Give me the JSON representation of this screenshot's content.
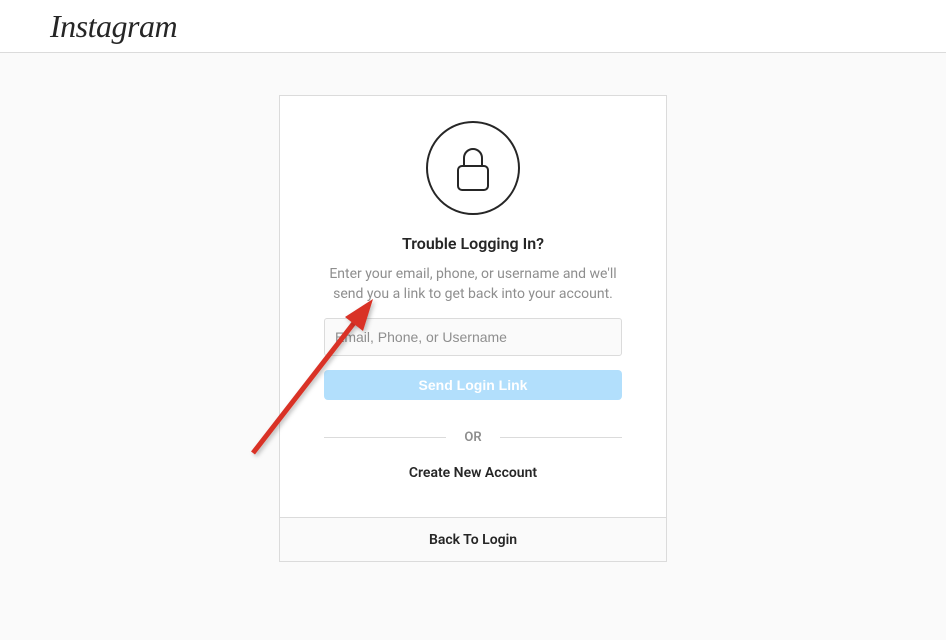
{
  "header": {
    "logo": "Instagram"
  },
  "card": {
    "title": "Trouble Logging In?",
    "description": "Enter your email, phone, or username and we'll send you a link to get back into your account.",
    "input_placeholder": "Email, Phone, or Username",
    "send_button": "Send Login Link",
    "divider": "OR",
    "create_account": "Create New Account",
    "back_to_login": "Back To Login"
  }
}
